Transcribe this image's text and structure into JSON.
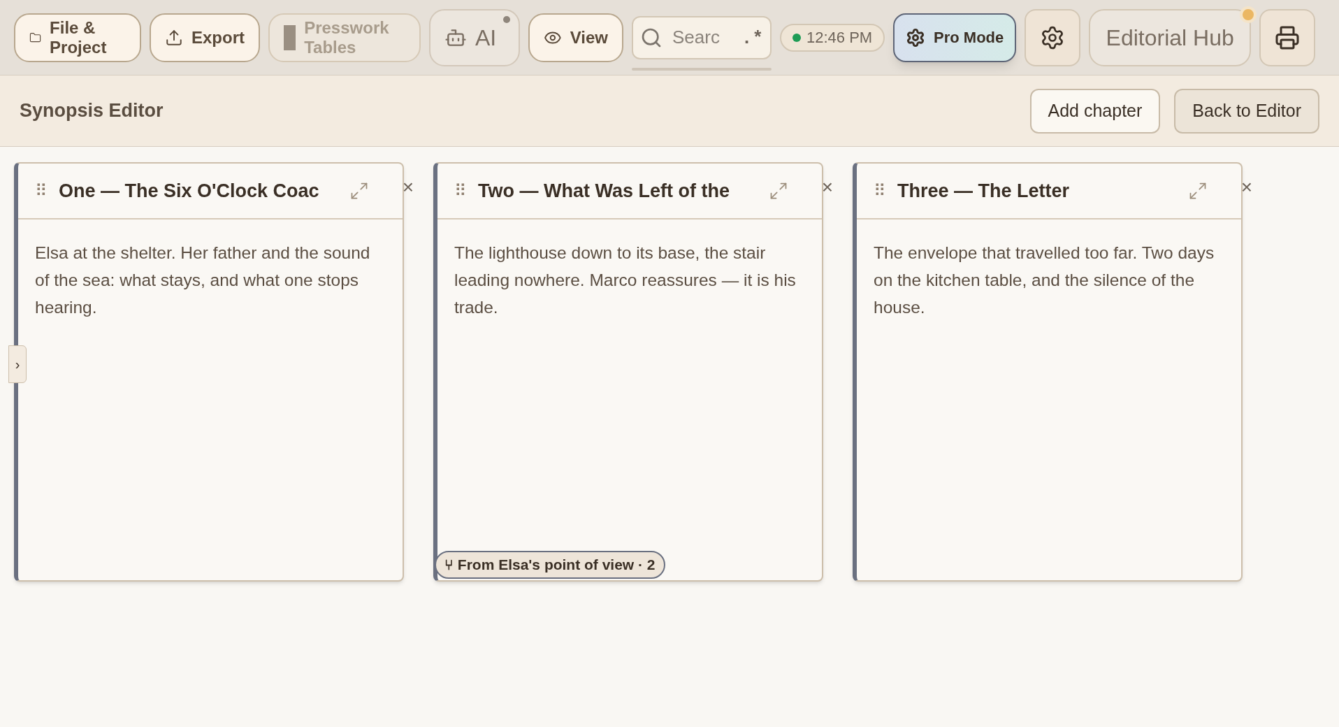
{
  "toolbar": {
    "items": [
      {
        "kind": "folder",
        "label": "File & Project",
        "disabled": false
      },
      {
        "kind": "export",
        "label": "Export",
        "disabled": false
      },
      {
        "kind": "tables",
        "label": "Presswork Tables",
        "disabled": true
      },
      {
        "kind": "ai",
        "label": "AI",
        "disabled": false
      },
      {
        "kind": "view",
        "label": "View",
        "disabled": false
      }
    ],
    "search": {
      "placeholder": "Searc",
      "regex": ".*"
    },
    "clock": "12:46 PM",
    "pro_mode": {
      "label": "Pro Mode",
      "on": true
    },
    "hub": {
      "label": "Editorial Hub",
      "notification": true
    }
  },
  "header": {
    "title": "Synopsis Editor",
    "buttons": [
      "Add chapter",
      "Back to Editor"
    ]
  },
  "sidebar": {
    "toggle": "›",
    "expanded": false
  },
  "cards": [
    {
      "handle": "⠿",
      "title": "One — The Six O'Clock Coac",
      "close": "×",
      "text": "Elsa at the shelter. Her father and the sound of the sea: what stays, and what one stops hearing."
    },
    {
      "handle": "⠿",
      "title": "Two — What Was Left of the",
      "close": "×",
      "text": "The lighthouse down to its base, the stair leading nowhere. Marco reassures — it is his trade.",
      "badge": "⑂ From Elsa's point of view · 2"
    },
    {
      "handle": "⠿",
      "title": "Three — The Letter",
      "close": "×",
      "text": "The envelope that travelled too far. Two days on the kitchen table, and the silence of the house."
    }
  ]
}
